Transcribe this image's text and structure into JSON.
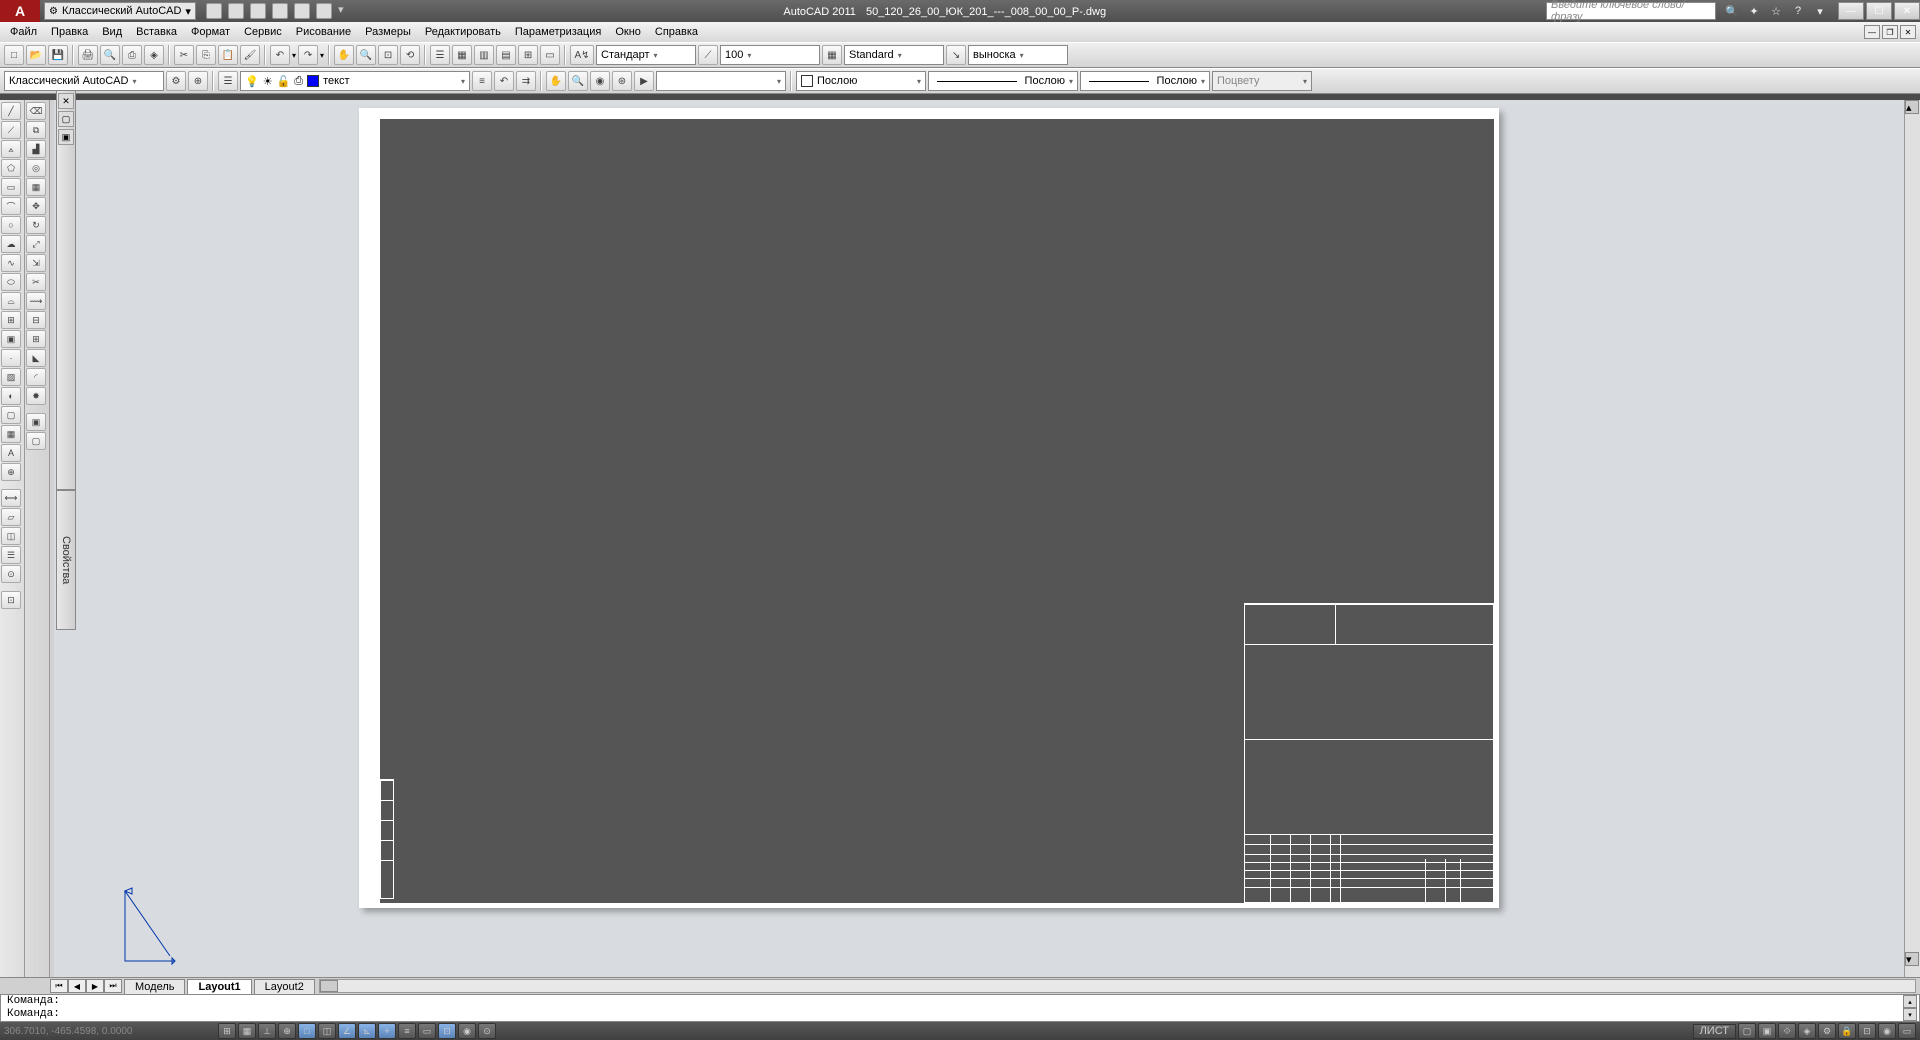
{
  "app": {
    "title_prefix": "AutoCAD 2011",
    "document": "50_120_26_00_ЮК_201_---_008_00_00_Р-.dwg",
    "workspace": "Классический AutoCAD",
    "search_placeholder": "Введите ключевое слово/фразу"
  },
  "menus": [
    "Файл",
    "Правка",
    "Вид",
    "Вставка",
    "Формат",
    "Сервис",
    "Рисование",
    "Размеры",
    "Редактировать",
    "Параметризация",
    "Окно",
    "Справка"
  ],
  "toolbar1": {
    "text_style": "Стандарт",
    "dim_scale": "100",
    "dim_style": "Standard",
    "multileader": "выноска"
  },
  "toolbar2": {
    "workspace_dd": "Классический AutoCAD",
    "layer": "текст",
    "color": "Послою",
    "linetype": "Послою",
    "lineweight": "Послою",
    "plotstyle": "Поцвету"
  },
  "palette_label": "Свойства",
  "layout_tabs": {
    "model": "Модель",
    "layout1": "Layout1",
    "layout2": "Layout2"
  },
  "command": {
    "line1": "Команда:",
    "line2": "Команда:"
  },
  "status": {
    "coords": "306.7010, -465.4598, 0.0000",
    "space": "ЛИСТ"
  }
}
